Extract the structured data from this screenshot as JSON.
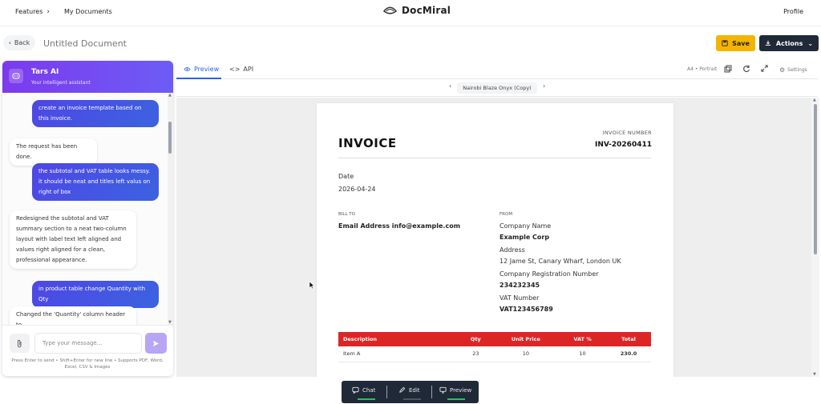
{
  "nav": {
    "features": "Features",
    "my_documents": "My Documents",
    "brand": "DocMiral",
    "profile": "Profile"
  },
  "doc": {
    "back": "Back",
    "title": "Untitled Document",
    "save": "Save",
    "actions": "Actions"
  },
  "chat": {
    "assistant_name": "Tars AI",
    "assistant_sub": "Your intelligent assistant",
    "messages": [
      {
        "role": "user",
        "text": "create an invoice template based on this invoice."
      },
      {
        "role": "bot",
        "text": "The request has been done."
      },
      {
        "role": "user",
        "text": "the subtotal and VAT table looks messy. it should be neat and titles left valus on right of box"
      },
      {
        "role": "bot",
        "text": "Redesigned the subtotal and VAT summary section to a neat two-column layout with label text left aligned and values right aligned for a clean, professional appearance."
      },
      {
        "role": "user",
        "text": "in product table change Quantity with Qty"
      },
      {
        "role": "bot",
        "text": "Changed the 'Quantity' column header to"
      }
    ],
    "input_placeholder": "Type your message...",
    "hint": "Press Enter to send • Shift+Enter for new line • Supports PDF, Word, Excel, CSV & Images"
  },
  "preview": {
    "tab_preview": "Preview",
    "tab_api": "API",
    "page_format": "A4 • Portrait",
    "settings": "Settings",
    "template_name": "Nairobi Blaze Onyx (Copy)"
  },
  "invoice": {
    "title": "INVOICE",
    "number_label": "INVOICE NUMBER",
    "number": "INV-20260411",
    "date_label": "Date",
    "date": "2026-04-24",
    "bill_to_label": "BILL TO",
    "bill_to": "Email Address info@example.com",
    "from_label": "FROM",
    "from": {
      "company_label": "Company Name",
      "company": "Example Corp",
      "address_label": "Address",
      "address": "12 Jame St, Canary Wharf, London UK",
      "reg_label": "Company Registration Number",
      "reg": "234232345",
      "vat_label": "VAT Number",
      "vat": "VAT123456789"
    },
    "table": {
      "headers": [
        "Description",
        "Qty",
        "Unit Price",
        "VAT %",
        "Total"
      ],
      "rows": [
        [
          "Item A",
          "23",
          "10",
          "10",
          "230.0"
        ]
      ]
    }
  },
  "bottom": {
    "chat": "Chat",
    "edit": "Edit",
    "preview": "Preview"
  },
  "colors": {
    "accent_purple": "#7c3aed",
    "user_bubble": "#4f46e5",
    "save_yellow": "#f4b400",
    "dark": "#1f2937",
    "table_red": "#dc2626",
    "tab_blue": "#2563eb"
  }
}
